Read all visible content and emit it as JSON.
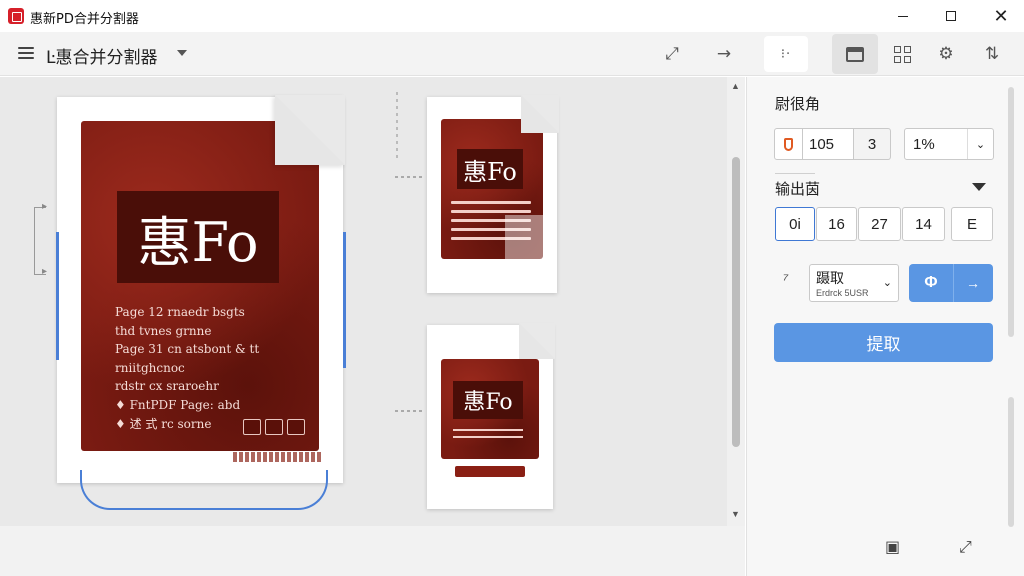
{
  "window": {
    "title": "惠新PD合并分割器",
    "icons": [
      "app-logo-icon",
      "minimize-icon",
      "maximize-icon",
      "close-icon"
    ]
  },
  "toolbar": {
    "doc_title": "Ŀ惠合并分割器",
    "icons": [
      "menu-icon",
      "dropdown-caret-icon",
      "expand-icon",
      "arrow-right-icon",
      "view-mode-icon",
      "panel-icon",
      "grid-icon",
      "gear-icon",
      "share-icon"
    ],
    "view_mode_glyph": "⁝·"
  },
  "canvas": {
    "main_page": {
      "logo": "惠Fo",
      "lines": [
        "Page 12 rnaedr bsgts",
        "thd tvnes grnne",
        "Page 31 cn atsbont & tt",
        "rniitghcnoc",
        "rdstr cx sraroehr",
        "♦ FntPDF Page: abd",
        "♦ 述 式 rc sorne"
      ]
    },
    "thumb1": {
      "logo": "惠Fo"
    },
    "thumb2": {
      "logo": "惠Fo"
    }
  },
  "sidebar": {
    "section1_label": "尉很角",
    "page_start": "105",
    "page_count": "3",
    "scale_value": "1%",
    "section2_label": "输出茵",
    "output_fields": [
      "0i",
      "16",
      "27",
      "14",
      "E"
    ],
    "extract_select_label": "蹑取",
    "extract_select_sub": "Erdrck 5USR",
    "action_glyph": "Φ",
    "extract_button": "提取"
  },
  "footer": {
    "icons": [
      "save-icon",
      "fullscreen-icon"
    ]
  },
  "colors": {
    "accent": "#5a96e3",
    "selection": "#4a7fd6",
    "brand_red": "#d6202a",
    "poster_red": "#7a1b12"
  }
}
